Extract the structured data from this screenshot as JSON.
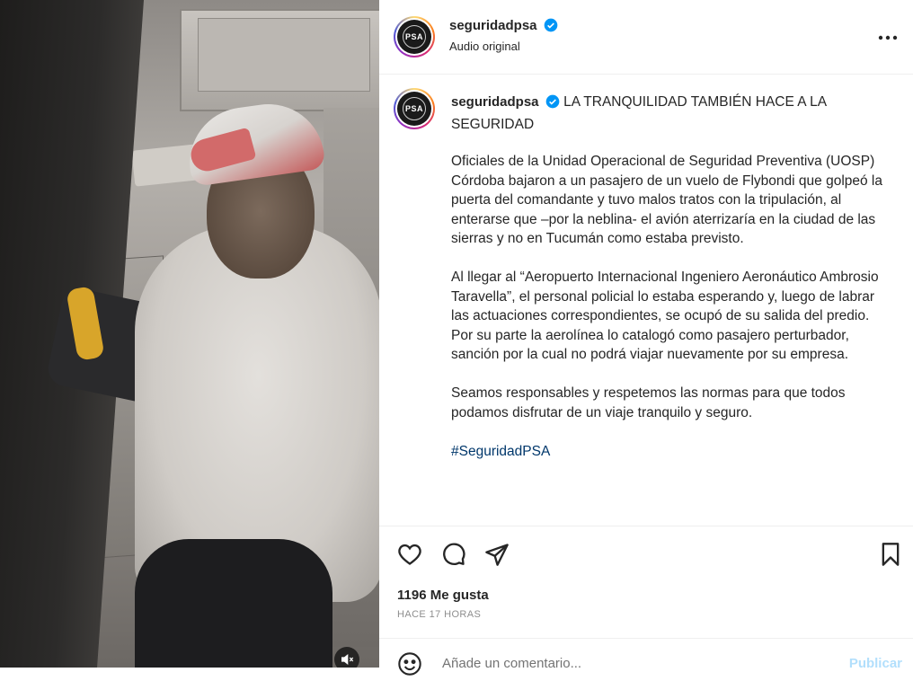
{
  "post": {
    "username": "seguridadpsa",
    "audio_label": "Audio original",
    "avatar_text": "PSA",
    "caption_username": "seguridadpsa",
    "caption_title": "LA TRANQUILIDAD TAMBIÉN HACE A LA SEGURIDAD",
    "paragraph_1": "Oficiales de la Unidad Operacional de Seguridad Preventiva (UOSP) Córdoba bajaron a un pasajero de un vuelo de Flybondi que golpeó la puerta del comandante y tuvo malos tratos con la tripulación, al enterarse que –por la neblina- el avión aterrizaría en la ciudad de las sierras y no en Tucumán como estaba previsto.",
    "paragraph_2": "Al llegar al “Aeropuerto Internacional Ingeniero Aeronáutico Ambrosio Taravella”, el personal policial lo estaba esperando y, luego de labrar las actuaciones correspondientes, se ocupó de su salida del predio. Por su parte la aerolínea lo catalogó como pasajero perturbador, sanción por la cual no podrá viajar nuevamente por su empresa.",
    "paragraph_3": "Seamos responsables y respetemos las normas para que todos podamos disfrutar de un viaje tranquilo y seguro.",
    "hashtag": "#SeguridadPSA",
    "likes": "1196 Me gusta",
    "time_ago": "HACE 17 HORAS"
  },
  "comment": {
    "placeholder": "Añade un comentario...",
    "publish_label": "Publicar"
  },
  "icons": {
    "like": "heart-icon",
    "comment": "comment-icon",
    "share": "share-icon",
    "save": "bookmark-icon",
    "more": "more-options-icon",
    "emoji": "emoji-icon",
    "mute": "muted-audio-icon",
    "verified": "verified-badge-icon"
  },
  "colors": {
    "text": "#262626",
    "secondary": "#8e8e8e",
    "link": "#00376b",
    "verified": "#0095f6",
    "publish_disabled": "#b2dffc"
  }
}
